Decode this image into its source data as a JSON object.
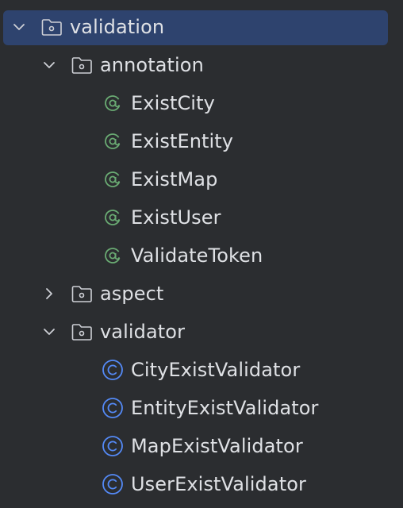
{
  "tree": {
    "root": {
      "label": "validation",
      "expanded": true,
      "selected": true,
      "icon": "package-folder-icon"
    },
    "annotation": {
      "label": "annotation",
      "expanded": true,
      "icon": "package-folder-icon"
    },
    "annotation_items": [
      {
        "label": "ExistCity",
        "icon": "annotation-icon"
      },
      {
        "label": "ExistEntity",
        "icon": "annotation-icon"
      },
      {
        "label": "ExistMap",
        "icon": "annotation-icon"
      },
      {
        "label": "ExistUser",
        "icon": "annotation-icon"
      },
      {
        "label": "ValidateToken",
        "icon": "annotation-icon"
      }
    ],
    "aspect": {
      "label": "aspect",
      "expanded": false,
      "icon": "package-folder-icon"
    },
    "validator": {
      "label": "validator",
      "expanded": true,
      "icon": "package-folder-icon"
    },
    "validator_items": [
      {
        "label": "CityExistValidator",
        "icon": "class-icon"
      },
      {
        "label": "EntityExistValidator",
        "icon": "class-icon"
      },
      {
        "label": "MapExistValidator",
        "icon": "class-icon"
      },
      {
        "label": "UserExistValidator",
        "icon": "class-icon"
      }
    ]
  },
  "colors": {
    "background": "#2b2d30",
    "selection": "#2e436e",
    "text": "#dfe1e5",
    "annotation_icon": "#6aab73",
    "class_icon": "#548af7",
    "folder_icon": "#ced0d6"
  }
}
